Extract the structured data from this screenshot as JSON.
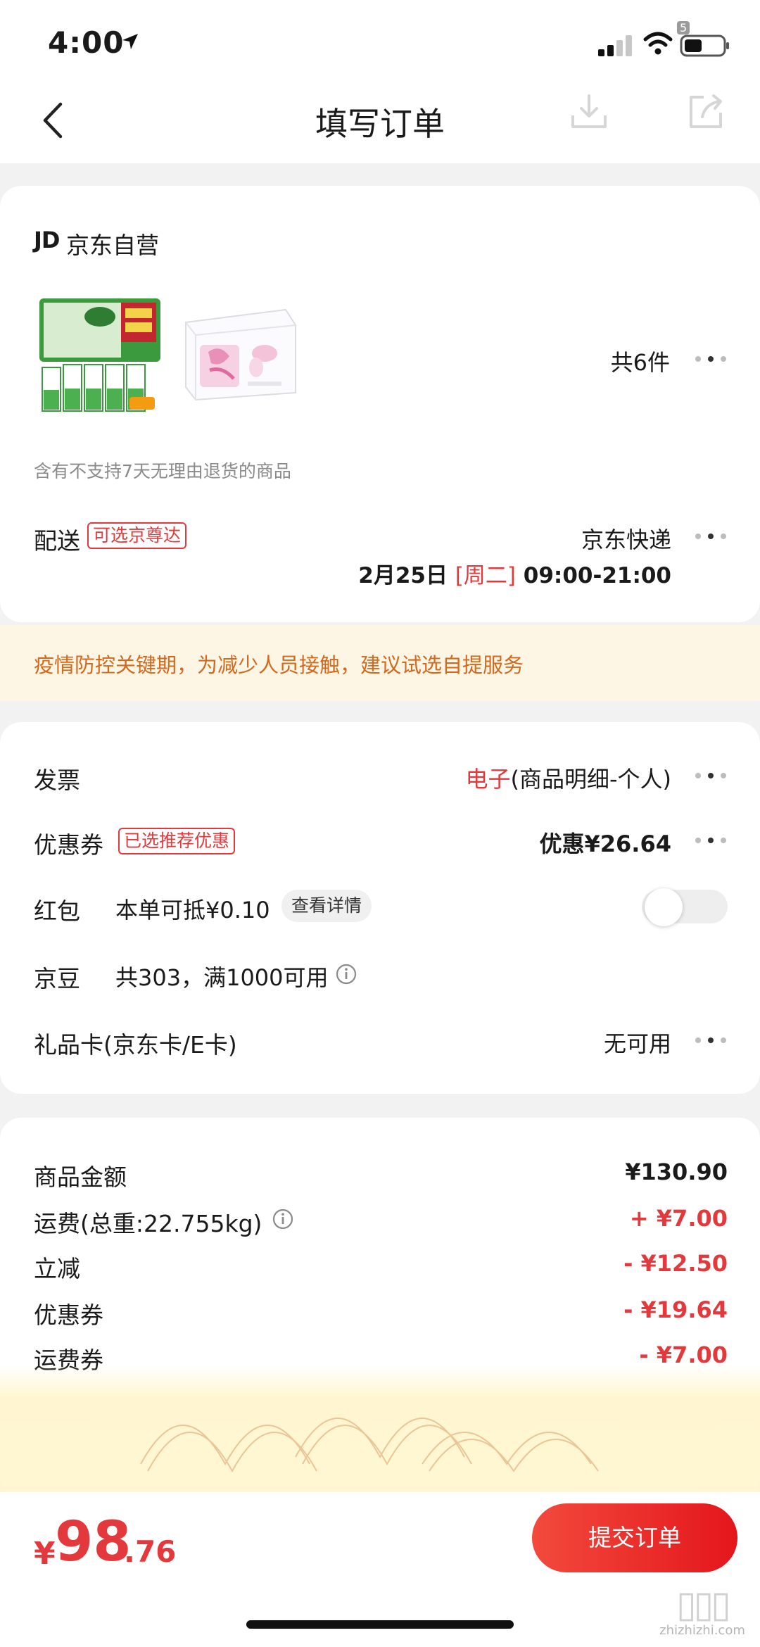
{
  "status_bar": {
    "time": "4:00",
    "battery_badge": "5"
  },
  "header": {
    "title": "填写订单"
  },
  "shop": {
    "logo": "JD",
    "name": "京东自营",
    "item_count": "共6件",
    "return_note": "含有不支持7天无理由退货的商品"
  },
  "delivery": {
    "label": "配送",
    "tag": "可选京尊达",
    "carrier": "京东快递",
    "date": "2月25日",
    "weekday": "[周二]",
    "time_range": "09:00-21:00"
  },
  "notice": {
    "text": "疫情防控关键期，为减少人员接触，建议试选自提服务"
  },
  "invoice": {
    "label": "发票",
    "type": "电子",
    "detail": "(商品明细-个人)"
  },
  "coupon": {
    "label": "优惠券",
    "tag": "已选推荐优惠",
    "value": "优惠¥26.64"
  },
  "red_packet": {
    "label": "红包",
    "text": "本单可抵¥0.10",
    "detail_button": "查看详情",
    "enabled": false
  },
  "jingdou": {
    "label": "京豆",
    "text": "共303，满1000可用"
  },
  "gift_card": {
    "label": "礼品卡(京东卡/E卡)",
    "value": "无可用"
  },
  "summary": {
    "rows": [
      {
        "label": "商品金额",
        "value": "¥130.90",
        "color": "#1a1a1a"
      },
      {
        "label": "运费(总重:22.755kg)",
        "value": "+ ¥7.00",
        "color": "#e4393c"
      },
      {
        "label": "立减",
        "value": "- ¥12.50",
        "color": "#e4393c"
      },
      {
        "label": "优惠券",
        "value": "- ¥19.64",
        "color": "#e4393c"
      },
      {
        "label": "运费券",
        "value": "- ¥7.00",
        "color": "#e4393c"
      }
    ]
  },
  "footer": {
    "currency": "¥",
    "price_int": "98",
    "price_dec": ".76",
    "submit": "提交订单"
  },
  "watermark": {
    "text": "zhizhizhi.com"
  },
  "colors": {
    "accent": "#e4393c",
    "notice_bg": "#fef6e4",
    "notice_text": "#d2691e"
  }
}
